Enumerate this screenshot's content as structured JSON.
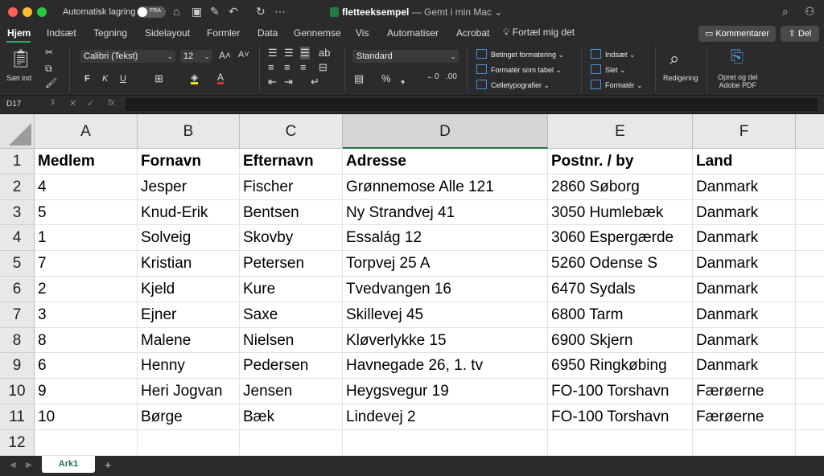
{
  "titlebar": {
    "autosave_label": "Automatisk lagring",
    "autosave_state": "FRA",
    "doc_name": "fletteeksempel",
    "doc_status": " — Gemt i min Mac ⌄"
  },
  "tabs": [
    "Hjem",
    "Indsæt",
    "Tegning",
    "Sidelayout",
    "Formler",
    "Data",
    "Gennemse",
    "Vis",
    "Automatiser",
    "Acrobat"
  ],
  "tell_me": "Fortæl mig det",
  "comment_label": "Kommentarer",
  "share_label": "Del",
  "ribbon": {
    "paste_label": "Sæt ind",
    "font_name": "Calibri (Tekst)",
    "font_size": "12",
    "number_format": "Standard",
    "cond_format": "Betinget formatering",
    "format_table": "Formatér som tabel",
    "cell_styles": "Celletypografier",
    "insert": "Indsæt",
    "delete": "Slet",
    "format": "Formatér",
    "editing": "Redigering",
    "acrobat_line1": "Opret og del",
    "acrobat_line2": "Adobe PDF"
  },
  "formula_bar": {
    "name_box": "D17",
    "fx": "fx"
  },
  "sheet": {
    "columns": [
      "A",
      "B",
      "C",
      "D",
      "E",
      "F"
    ],
    "row_numbers": [
      "1",
      "2",
      "3",
      "4",
      "5",
      "6",
      "7",
      "8",
      "9",
      "10",
      "11",
      "12"
    ],
    "rows": [
      [
        "Medlem",
        "Fornavn",
        "Efternavn",
        "Adresse",
        "Postnr. / by",
        "Land"
      ],
      [
        "4",
        "Jesper",
        "Fischer",
        "Grønnemose Alle 121",
        "2860 Søborg",
        "Danmark"
      ],
      [
        "5",
        "Knud-Erik",
        "Bentsen",
        "Ny Strandvej 41",
        "3050 Humlebæk",
        "Danmark"
      ],
      [
        "1",
        "Solveig",
        "Skovby",
        "Essalág 12",
        "3060 Espergærde",
        "Danmark"
      ],
      [
        "7",
        "Kristian",
        "Petersen",
        "Torpvej 25 A",
        "5260 Odense S",
        "Danmark"
      ],
      [
        "2",
        "Kjeld",
        "Kure",
        "Tvedvangen 16",
        "6470 Sydals",
        "Danmark"
      ],
      [
        "3",
        "Ejner",
        "Saxe",
        "Skillevej 45",
        "6800 Tarm",
        "Danmark"
      ],
      [
        "8",
        "Malene",
        "Nielsen",
        "Kløverlykke 15",
        "6900 Skjern",
        "Danmark"
      ],
      [
        "6",
        "Henny",
        "Pedersen",
        "Havnegade 26, 1. tv",
        "6950 Ringkøbing",
        "Danmark"
      ],
      [
        "9",
        "Heri Jogvan",
        "Jensen",
        "Heygsvegur 19",
        "FO-100 Torshavn",
        "Færøerne"
      ],
      [
        "10",
        "Børge",
        "Bæk",
        "Lindevej 2",
        "FO-100 Torshavn",
        "Færøerne"
      ],
      [
        "",
        "",
        "",
        "",
        "",
        ""
      ]
    ],
    "sheet_tab": "Ark1",
    "add_sheet": "+"
  },
  "colors": {
    "accent_green": "#217346",
    "titlebar_bg": "#2b2b2b"
  }
}
